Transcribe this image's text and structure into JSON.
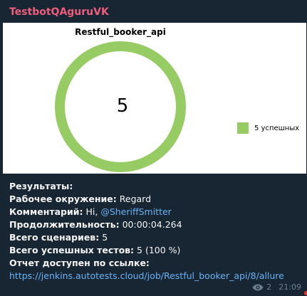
{
  "message": {
    "sender": "TestbotQAguruVK",
    "results_header": "Результаты:",
    "environment_label": "Рабочее окружение:",
    "environment_value": "Regard",
    "comment_label": "Комментарий:",
    "comment_prefix": "Hi,",
    "comment_mention": "@SheriffSmitter",
    "duration_label": "Продолжительность:",
    "duration_value": "00:00:04.264",
    "scenarios_label": "Всего сценариев:",
    "scenarios_value": "5",
    "passed_label": "Всего успешных тестов:",
    "passed_value": "5 (100 %)",
    "report_label": "Отчет доступен по ссылке:",
    "report_url": "https://jenkins.autotests.cloud/job/Restful_booker_api/8/allure",
    "views": "2",
    "time": "21:09"
  },
  "colors": {
    "sender": "#ee5e7c",
    "link": "#6ab3f3",
    "passed": "#97cc64"
  },
  "chart_data": {
    "type": "pie",
    "title": "Restful_booker_api",
    "center_label": "5",
    "slices": [
      {
        "label": "5 успешных",
        "value": 5,
        "color": "#97cc64"
      }
    ]
  }
}
